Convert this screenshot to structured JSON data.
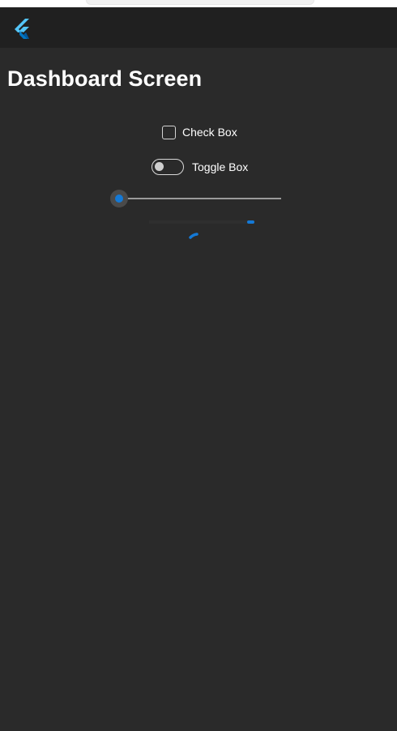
{
  "app": {
    "logo_icon": "flutter-logo-icon",
    "accent_color": "#1479d6"
  },
  "page": {
    "title": "Dashboard Screen"
  },
  "controls": {
    "checkbox": {
      "label": "Check Box",
      "checked": false
    },
    "toggle": {
      "label": "Toggle Box",
      "on": false
    },
    "slider": {
      "value": 0
    },
    "linear_progress": {
      "state": "indeterminate"
    },
    "circular_progress": {
      "state": "indeterminate"
    }
  }
}
